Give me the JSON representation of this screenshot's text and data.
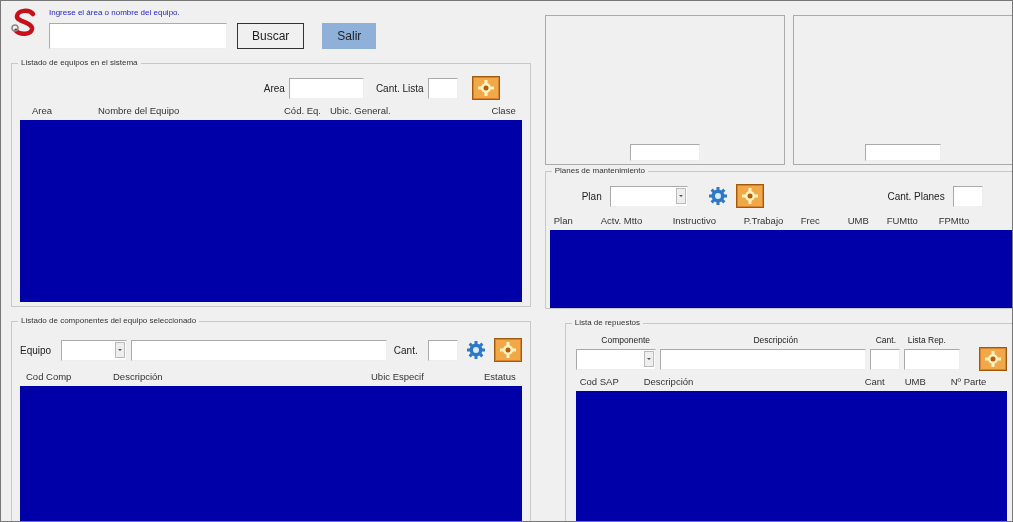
{
  "header": {
    "prompt": "Ingrese el área o nombre del equipo.",
    "buttons": [
      {
        "label": "Buscar",
        "kind": "default"
      },
      {
        "label": "Salir",
        "kind": "accent"
      }
    ]
  },
  "equipment_list": {
    "title": "Listado de equipos en el sistema",
    "filters": [
      {
        "label": "Area"
      },
      {
        "label": "Cant. Lista"
      }
    ],
    "columns": [
      "Area",
      "Nombre del Equipo",
      "Cód. Eq.",
      "Ubic. General.",
      "Clase"
    ]
  },
  "maintenance_plans": {
    "title": "Planes de mantenimiento",
    "plan_label": "Plan",
    "count_label": "Cant. Planes",
    "columns": [
      "Plan",
      "Actv. Mtto",
      "Instructivo",
      "P.Trabajo",
      "Frec",
      "UMB",
      "FUMtto",
      "FPMtto"
    ]
  },
  "components": {
    "title": "Listado de componentes del equipo seleccionado",
    "equipment_label": "Equipo",
    "count_label": "Cant.",
    "columns": [
      "Cod Comp",
      "Descripción",
      "Ubic Especif",
      "Estatus"
    ]
  },
  "spare_parts": {
    "title": "Lista de repuestos",
    "field_labels": [
      "Componente",
      "Descripción",
      "Cant.",
      "Lista Rep."
    ],
    "columns": [
      "Cod SAP",
      "Descripción",
      "Cant",
      "UMB",
      "Nº Parte"
    ]
  }
}
